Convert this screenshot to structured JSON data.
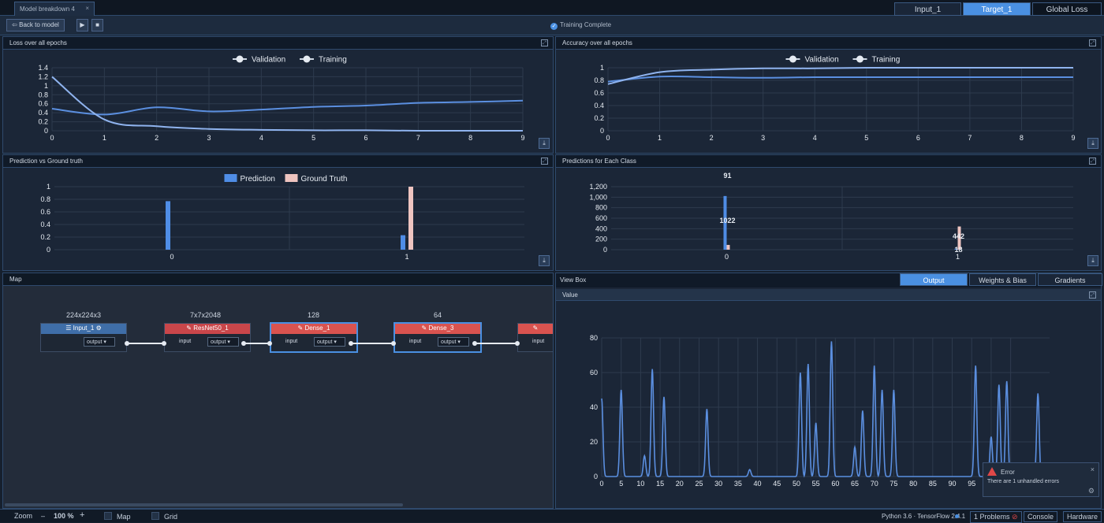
{
  "window": {
    "doc_tab": "Model breakdown 4",
    "right_tabs": [
      "Input_1",
      "Target_1",
      "Global Loss"
    ],
    "active_right_tab": "Target_1"
  },
  "toolbar": {
    "back_label": "Back to model",
    "status": "Training Complete"
  },
  "colors": {
    "accent": "#4a90e2",
    "validation": "#5b8fe0",
    "training": "#8fb3ee",
    "prediction": "#4f8de6",
    "ground_truth": "#eec4c0",
    "node_red": "#d9534f",
    "node_blue": "#3f6ea8"
  },
  "panels": {
    "loss": {
      "title": "Loss over all epochs"
    },
    "accuracy": {
      "title": "Accuracy over all epochs"
    },
    "pred_gt": {
      "title": "Prediction vs Ground truth"
    },
    "pred_class": {
      "title": "Predictions for Each Class"
    },
    "map": {
      "title": "Map"
    },
    "viewbox": {
      "title": "View Box",
      "tabs": [
        "Output",
        "Weights & Bias",
        "Gradients"
      ],
      "active_tab": "Output",
      "sub_title": "Value"
    }
  },
  "chart_data": [
    {
      "type": "line",
      "x": [
        0,
        1,
        2,
        3,
        4,
        5,
        6,
        7,
        8,
        9
      ],
      "series": [
        {
          "name": "Validation",
          "values": [
            0.49,
            0.36,
            0.52,
            0.43,
            0.47,
            0.53,
            0.56,
            0.62,
            0.64,
            0.67
          ]
        },
        {
          "name": "Training",
          "values": [
            1.2,
            0.25,
            0.1,
            0.04,
            0.02,
            0.01,
            0.01,
            0.0,
            0.0,
            0.0
          ]
        }
      ],
      "legend": [
        "Validation",
        "Training"
      ],
      "xticks": [
        "0",
        "1",
        "2",
        "3",
        "4",
        "5",
        "6",
        "7",
        "8",
        "9"
      ],
      "yticks": [
        "0",
        "0.2",
        "0.4",
        "0.6",
        "0.8",
        "1",
        "1.2",
        "1.4"
      ],
      "ylim": [
        0,
        1.4
      ],
      "grid": true,
      "legend_position": "top"
    },
    {
      "type": "line",
      "x": [
        0,
        1,
        2,
        3,
        4,
        5,
        6,
        7,
        8,
        9
      ],
      "series": [
        {
          "name": "Validation",
          "values": [
            0.78,
            0.86,
            0.85,
            0.84,
            0.85,
            0.85,
            0.85,
            0.85,
            0.85,
            0.85
          ]
        },
        {
          "name": "Training",
          "values": [
            0.74,
            0.93,
            0.97,
            0.99,
            0.99,
            1.0,
            1.0,
            1.0,
            1.0,
            1.0
          ]
        }
      ],
      "legend": [
        "Validation",
        "Training"
      ],
      "xticks": [
        "0",
        "1",
        "2",
        "3",
        "4",
        "5",
        "6",
        "7",
        "8",
        "9"
      ],
      "yticks": [
        "0",
        "0.2",
        "0.4",
        "0.6",
        "0.8",
        "1"
      ],
      "ylim": [
        0,
        1
      ],
      "grid": true,
      "legend_position": "top"
    },
    {
      "type": "bar",
      "categories": [
        "0",
        "1"
      ],
      "series": [
        {
          "name": "Prediction",
          "values": [
            0.77,
            0.23
          ]
        },
        {
          "name": "Ground Truth",
          "values": [
            0,
            1
          ]
        }
      ],
      "legend": [
        "Prediction",
        "Ground Truth"
      ],
      "yticks": [
        "0",
        "0.2",
        "0.4",
        "0.6",
        "0.8",
        "1"
      ],
      "ylim": [
        0,
        1
      ],
      "grid": true,
      "legend_position": "top"
    },
    {
      "type": "bar",
      "categories": [
        "0",
        "1"
      ],
      "series": [
        {
          "values": [
            1022,
            18
          ]
        },
        {
          "values": [
            91,
            442
          ]
        }
      ],
      "data_labels": [
        "1022",
        "91",
        "18",
        "442"
      ],
      "yticks": [
        "0",
        "200",
        "400",
        "600",
        "800",
        "1,000",
        "1,200"
      ],
      "ylim": [
        0,
        1200
      ],
      "grid": true
    },
    {
      "type": "line",
      "x_range": [
        0,
        115
      ],
      "xticks": [
        "0",
        "5",
        "10",
        "15",
        "20",
        "25",
        "30",
        "35",
        "40",
        "45",
        "50",
        "55",
        "60",
        "65",
        "70",
        "75",
        "80",
        "85",
        "90",
        "95",
        "100",
        "105"
      ],
      "yticks": [
        "0",
        "20",
        "40",
        "60",
        "80"
      ],
      "ylim": [
        0,
        80
      ],
      "peaks": [
        [
          0,
          45
        ],
        [
          5,
          50
        ],
        [
          11,
          12
        ],
        [
          13,
          62
        ],
        [
          16,
          46
        ],
        [
          27,
          39
        ],
        [
          38,
          4
        ],
        [
          51,
          60
        ],
        [
          53,
          65
        ],
        [
          55,
          31
        ],
        [
          59,
          78
        ],
        [
          65,
          17
        ],
        [
          67,
          38
        ],
        [
          70,
          64
        ],
        [
          72,
          50
        ],
        [
          75,
          50
        ],
        [
          96,
          64
        ],
        [
          100,
          23
        ],
        [
          102,
          53
        ],
        [
          104,
          55
        ],
        [
          112,
          48
        ]
      ],
      "grid": true
    }
  ],
  "map": {
    "nodes": [
      {
        "name": "Input_1",
        "dim": "224x224x3",
        "out": "output"
      },
      {
        "name": "ResNet50_1",
        "dim": "7x7x2048",
        "in": "input",
        "out": "output"
      },
      {
        "name": "Dense_1",
        "dim": "128",
        "in": "input",
        "out": "output"
      },
      {
        "name": "Dense_3",
        "dim": "64",
        "in": "input",
        "out": "output"
      },
      {
        "in": "input"
      }
    ]
  },
  "statusbar": {
    "zoom_label": "Zoom",
    "zoom_minus": "–",
    "zoom_value": "100 %",
    "zoom_plus": "+",
    "map_label": "Map",
    "grid_label": "Grid",
    "versions": "Python 3.6 · TensorFlow 2.4.1",
    "problems": "1 Problems",
    "console": "Console",
    "hardware": "Hardware"
  },
  "toast": {
    "title": "Error",
    "message": "There are 1 unhandled errors"
  }
}
